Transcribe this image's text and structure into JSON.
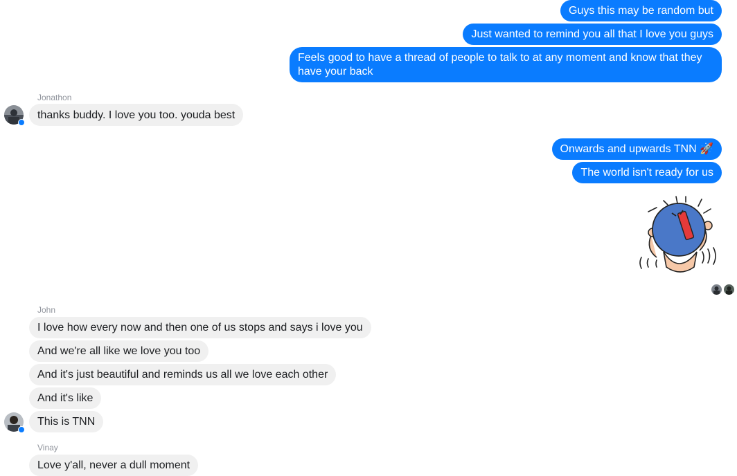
{
  "outgoing_group_1": [
    "Guys this may be random but",
    "Just wanted to remind you all that I love you guys",
    "Feels good to have a thread of people to talk to at any moment and know that they have your back"
  ],
  "jonathon": {
    "name": "Jonathon",
    "messages": [
      "thanks buddy. I love you too. youda best"
    ]
  },
  "outgoing_group_2": [
    "Onwards and upwards TNN 🚀",
    "The world isn't ready for us"
  ],
  "sticker": {
    "icon": "celebrating-blob-sticker-icon"
  },
  "john": {
    "name": "John",
    "messages": [
      "I love how every now and then one of us stops and says i love you",
      "And we're all like we love you too",
      "And it's just beautiful and reminds us all we love each other",
      "And it's like",
      "This is TNN"
    ]
  },
  "vinay": {
    "name": "Vinay",
    "messages": [
      "Love y'all, never a dull moment"
    ]
  },
  "colors": {
    "outgoing": "#0a7cff",
    "incoming": "#f0f0f0",
    "name": "#90949c"
  }
}
